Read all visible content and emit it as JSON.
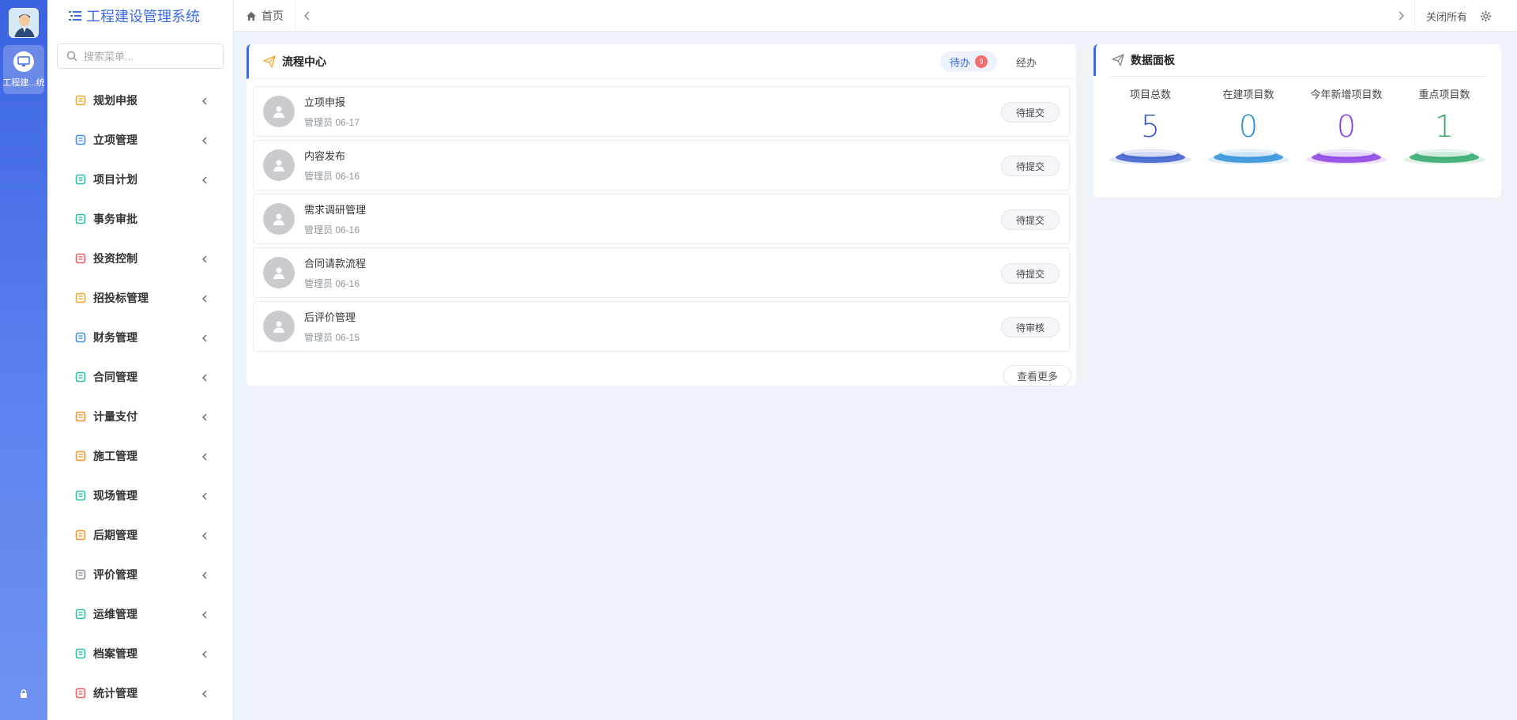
{
  "app": {
    "title": "工程建设管理系统",
    "rail_app_label": "工程建...统"
  },
  "search": {
    "placeholder": "搜索菜单..."
  },
  "menu": [
    {
      "label": "规划申报",
      "icon": "planning-icon",
      "color": "#f5a623",
      "has_children": true
    },
    {
      "label": "立项管理",
      "icon": "grid-icon",
      "color": "#3a8ee6",
      "has_children": true
    },
    {
      "label": "项目计划",
      "icon": "thumb-up-icon",
      "color": "#23c0a3",
      "has_children": true
    },
    {
      "label": "事务审批",
      "icon": "approval-icon",
      "color": "#23c0a3",
      "has_children": false
    },
    {
      "label": "投资控制",
      "icon": "investment-icon",
      "color": "#f05a5a",
      "has_children": true
    },
    {
      "label": "招投标管理",
      "icon": "bidding-icon",
      "color": "#f5a623",
      "has_children": true
    },
    {
      "label": "财务管理",
      "icon": "finance-icon",
      "color": "#3a8ee6",
      "has_children": true
    },
    {
      "label": "合同管理",
      "icon": "contract-icon",
      "color": "#23c0a3",
      "has_children": true
    },
    {
      "label": "计量支付",
      "icon": "payment-icon",
      "color": "#f5911e",
      "has_children": true
    },
    {
      "label": "施工管理",
      "icon": "wrench-icon",
      "color": "#f5911e",
      "has_children": true
    },
    {
      "label": "现场管理",
      "icon": "site-user-icon",
      "color": "#23c0a3",
      "has_children": true
    },
    {
      "label": "后期管理",
      "icon": "later-user-icon",
      "color": "#f5911e",
      "has_children": true
    },
    {
      "label": "评价管理",
      "icon": "send-icon",
      "color": "#8a8f99",
      "has_children": true
    },
    {
      "label": "运维管理",
      "icon": "location-icon",
      "color": "#23c0a3",
      "has_children": true
    },
    {
      "label": "档案管理",
      "icon": "archive-icon",
      "color": "#23c0a3",
      "has_children": true
    },
    {
      "label": "统计管理",
      "icon": "pie-icon",
      "color": "#f05a5a",
      "has_children": true
    }
  ],
  "topbar": {
    "home_label": "首页",
    "close_all_label": "关闭所有"
  },
  "process": {
    "title": "流程中心",
    "tabs": [
      {
        "label": "待办",
        "badge": "9"
      },
      {
        "label": "经办"
      }
    ],
    "tasks": [
      {
        "title": "立项申报",
        "meta": "管理员 06-17",
        "status": "待提交"
      },
      {
        "title": "内容发布",
        "meta": "管理员 06-16",
        "status": "待提交"
      },
      {
        "title": "需求调研管理",
        "meta": "管理员 06-16",
        "status": "待提交"
      },
      {
        "title": "合同请款流程",
        "meta": "管理员 06-16",
        "status": "待提交"
      },
      {
        "title": "后评价管理",
        "meta": "管理员 06-15",
        "status": "待审核"
      }
    ],
    "more_label": "查看更多"
  },
  "dashboard": {
    "title": "数据面板",
    "stats": [
      {
        "label": "项目总数",
        "value": "5",
        "color": "#3a5bcc"
      },
      {
        "label": "在建项目数",
        "value": "0",
        "color": "#2d8fd8"
      },
      {
        "label": "今年新增项目数",
        "value": "0",
        "color": "#8a3fe0"
      },
      {
        "label": "重点项目数",
        "value": "1",
        "color": "#2fa86a"
      }
    ]
  }
}
